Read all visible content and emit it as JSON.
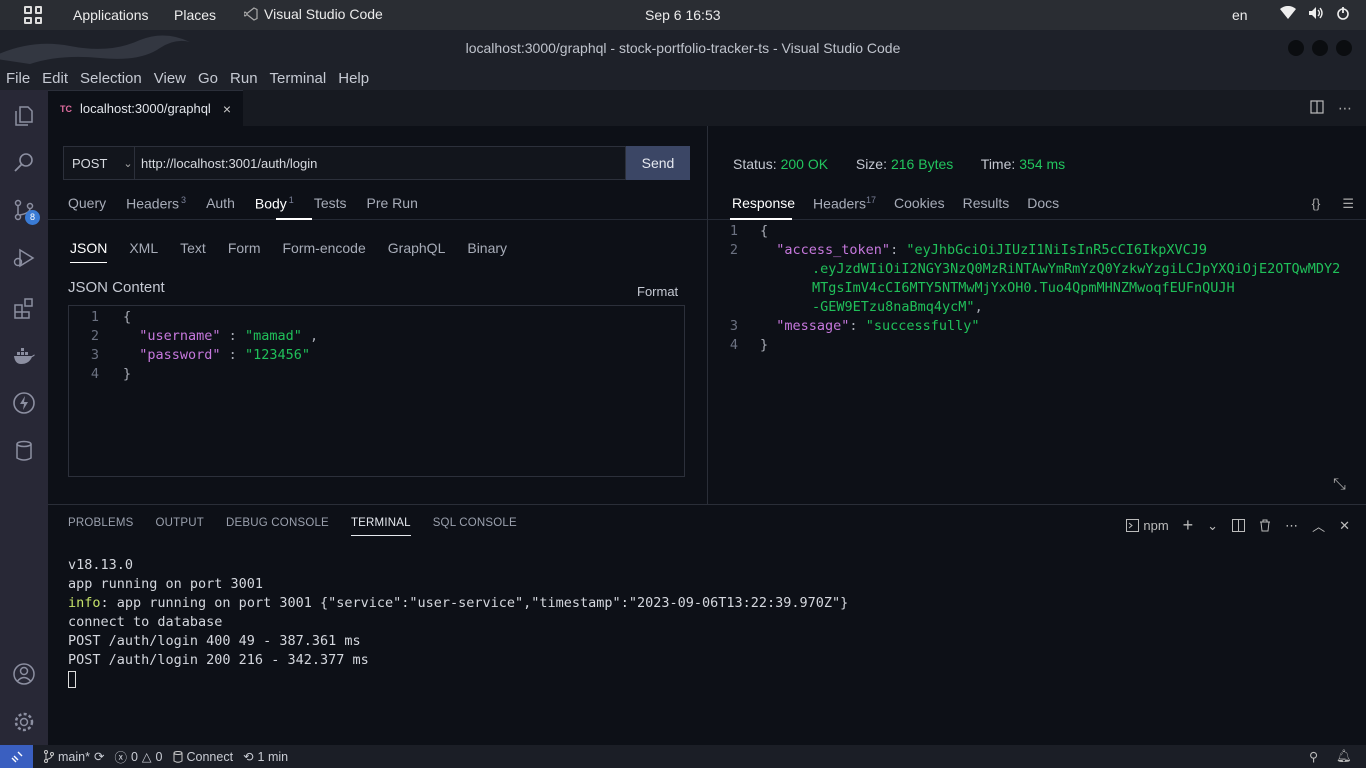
{
  "topbar": {
    "applications": "Applications",
    "places": "Places",
    "app_name": "Visual Studio Code",
    "clock": "Sep 6  16:53",
    "lang": "en"
  },
  "window": {
    "title": "localhost:3000/graphql - stock-portfolio-tracker-ts - Visual Studio Code"
  },
  "menu": [
    "File",
    "Edit",
    "Selection",
    "View",
    "Go",
    "Run",
    "Terminal",
    "Help"
  ],
  "activity": {
    "badge": "8",
    "icons": [
      "explorer-icon",
      "search-icon",
      "source-control-icon",
      "run-debug-icon",
      "extensions-icon",
      "docker-icon",
      "thunder-client-icon",
      "database-icon",
      "account-icon",
      "settings-gear-icon"
    ]
  },
  "editor_tab": {
    "prefix": "TC",
    "label": "localhost:3000/graphql",
    "close": "×"
  },
  "request": {
    "method": "POST",
    "url": "http://localhost:3001/auth/login",
    "send": "Send",
    "tabs": {
      "query": "Query",
      "headers": "Headers",
      "headers_count": "3",
      "auth": "Auth",
      "body": "Body",
      "body_count": "1",
      "tests": "Tests",
      "pre_run": "Pre Run"
    },
    "body_types": [
      "JSON",
      "XML",
      "Text",
      "Form",
      "Form-encode",
      "GraphQL",
      "Binary"
    ],
    "json_label": "JSON Content",
    "format": "Format",
    "json_lines": {
      "n1": "1",
      "n2": "2",
      "n3": "3",
      "n4": "4",
      "open": "{",
      "k1": "\"username\"",
      "sep1": " : ",
      "v1": "\"mamad\"",
      "c1": " ,",
      "k2": "\"password\"",
      "sep2": " : ",
      "v2": "\"123456\"",
      "close": "}"
    }
  },
  "response": {
    "status_label": "Status:",
    "status_value": "200 OK",
    "size_label": "Size:",
    "size_value": "216 Bytes",
    "time_label": "Time:",
    "time_value": "354 ms",
    "tabs": {
      "response": "Response",
      "headers": "Headers",
      "headers_count": "17",
      "cookies": "Cookies",
      "results": "Results",
      "docs": "Docs"
    },
    "braces_icon": "{}",
    "lines": {
      "n1": "1",
      "n2": "2",
      "n3": "3",
      "n4": "4",
      "open": "{",
      "k1": "\"access_token\"",
      "colon1": ": ",
      "t1": "\"eyJhbGciOiJIUzI1NiIsInR5cCI6IkpXVCJ9",
      "t2": ".eyJzdWIiOiI2NGY3NzQ0MzRiNTAwYmRmYzQ0YzkwYzgiLCJpYXQiOjE2OTQwMDY2",
      "t3": "MTgsImV4cCI6MTY5NTMwMjYxOH0.Tuo4QpmMHNZMwoqfEUFnQUJH",
      "t4": "-GEW9ETzu8naBmq4ycM\"",
      "comma": ",",
      "k2": "\"message\"",
      "colon2": ": ",
      "v2": "\"successfully\"",
      "close": "}"
    }
  },
  "panel": {
    "tabs": [
      "PROBLEMS",
      "OUTPUT",
      "DEBUG CONSOLE",
      "TERMINAL",
      "SQL CONSOLE"
    ],
    "shell": "npm",
    "terminal": {
      "l1": "v18.13.0",
      "l2": "app running on port 3001",
      "l3_prefix": "info",
      "l3_rest": ": app running on port 3001 {\"service\":\"user-service\",\"timestamp\":\"2023-09-06T13:22:39.970Z\"}",
      "l4": "connect to database",
      "l5": "POST /auth/login 400 49 - 387.361 ms",
      "l6": "POST /auth/login 200 216 - 342.377 ms"
    }
  },
  "statusbar": {
    "branch": "main*",
    "errors": "0",
    "warnings": "0",
    "connect": "Connect",
    "time": "1 min"
  }
}
